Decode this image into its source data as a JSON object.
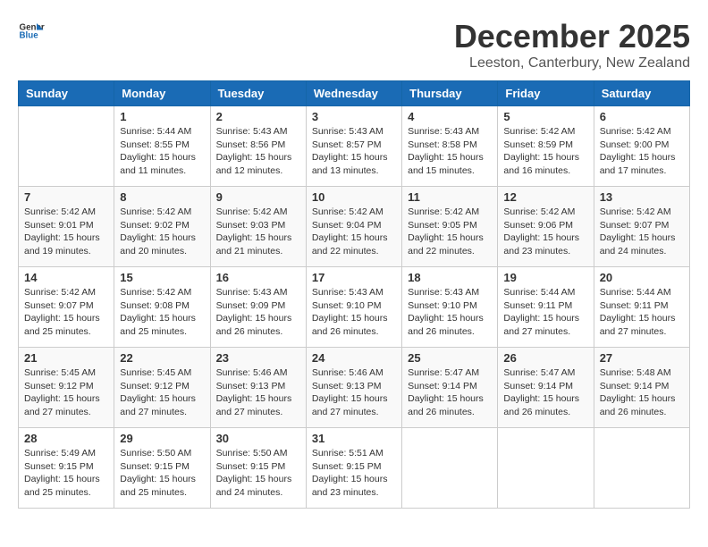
{
  "header": {
    "logo_general": "General",
    "logo_blue": "Blue",
    "month": "December 2025",
    "location": "Leeston, Canterbury, New Zealand"
  },
  "days_of_week": [
    "Sunday",
    "Monday",
    "Tuesday",
    "Wednesday",
    "Thursday",
    "Friday",
    "Saturday"
  ],
  "weeks": [
    [
      {
        "day": "",
        "sunrise": "",
        "sunset": "",
        "daylight": ""
      },
      {
        "day": "1",
        "sunrise": "Sunrise: 5:44 AM",
        "sunset": "Sunset: 8:55 PM",
        "daylight": "Daylight: 15 hours and 11 minutes."
      },
      {
        "day": "2",
        "sunrise": "Sunrise: 5:43 AM",
        "sunset": "Sunset: 8:56 PM",
        "daylight": "Daylight: 15 hours and 12 minutes."
      },
      {
        "day": "3",
        "sunrise": "Sunrise: 5:43 AM",
        "sunset": "Sunset: 8:57 PM",
        "daylight": "Daylight: 15 hours and 13 minutes."
      },
      {
        "day": "4",
        "sunrise": "Sunrise: 5:43 AM",
        "sunset": "Sunset: 8:58 PM",
        "daylight": "Daylight: 15 hours and 15 minutes."
      },
      {
        "day": "5",
        "sunrise": "Sunrise: 5:42 AM",
        "sunset": "Sunset: 8:59 PM",
        "daylight": "Daylight: 15 hours and 16 minutes."
      },
      {
        "day": "6",
        "sunrise": "Sunrise: 5:42 AM",
        "sunset": "Sunset: 9:00 PM",
        "daylight": "Daylight: 15 hours and 17 minutes."
      }
    ],
    [
      {
        "day": "7",
        "sunrise": "Sunrise: 5:42 AM",
        "sunset": "Sunset: 9:01 PM",
        "daylight": "Daylight: 15 hours and 19 minutes."
      },
      {
        "day": "8",
        "sunrise": "Sunrise: 5:42 AM",
        "sunset": "Sunset: 9:02 PM",
        "daylight": "Daylight: 15 hours and 20 minutes."
      },
      {
        "day": "9",
        "sunrise": "Sunrise: 5:42 AM",
        "sunset": "Sunset: 9:03 PM",
        "daylight": "Daylight: 15 hours and 21 minutes."
      },
      {
        "day": "10",
        "sunrise": "Sunrise: 5:42 AM",
        "sunset": "Sunset: 9:04 PM",
        "daylight": "Daylight: 15 hours and 22 minutes."
      },
      {
        "day": "11",
        "sunrise": "Sunrise: 5:42 AM",
        "sunset": "Sunset: 9:05 PM",
        "daylight": "Daylight: 15 hours and 22 minutes."
      },
      {
        "day": "12",
        "sunrise": "Sunrise: 5:42 AM",
        "sunset": "Sunset: 9:06 PM",
        "daylight": "Daylight: 15 hours and 23 minutes."
      },
      {
        "day": "13",
        "sunrise": "Sunrise: 5:42 AM",
        "sunset": "Sunset: 9:07 PM",
        "daylight": "Daylight: 15 hours and 24 minutes."
      }
    ],
    [
      {
        "day": "14",
        "sunrise": "Sunrise: 5:42 AM",
        "sunset": "Sunset: 9:07 PM",
        "daylight": "Daylight: 15 hours and 25 minutes."
      },
      {
        "day": "15",
        "sunrise": "Sunrise: 5:42 AM",
        "sunset": "Sunset: 9:08 PM",
        "daylight": "Daylight: 15 hours and 25 minutes."
      },
      {
        "day": "16",
        "sunrise": "Sunrise: 5:43 AM",
        "sunset": "Sunset: 9:09 PM",
        "daylight": "Daylight: 15 hours and 26 minutes."
      },
      {
        "day": "17",
        "sunrise": "Sunrise: 5:43 AM",
        "sunset": "Sunset: 9:10 PM",
        "daylight": "Daylight: 15 hours and 26 minutes."
      },
      {
        "day": "18",
        "sunrise": "Sunrise: 5:43 AM",
        "sunset": "Sunset: 9:10 PM",
        "daylight": "Daylight: 15 hours and 26 minutes."
      },
      {
        "day": "19",
        "sunrise": "Sunrise: 5:44 AM",
        "sunset": "Sunset: 9:11 PM",
        "daylight": "Daylight: 15 hours and 27 minutes."
      },
      {
        "day": "20",
        "sunrise": "Sunrise: 5:44 AM",
        "sunset": "Sunset: 9:11 PM",
        "daylight": "Daylight: 15 hours and 27 minutes."
      }
    ],
    [
      {
        "day": "21",
        "sunrise": "Sunrise: 5:45 AM",
        "sunset": "Sunset: 9:12 PM",
        "daylight": "Daylight: 15 hours and 27 minutes."
      },
      {
        "day": "22",
        "sunrise": "Sunrise: 5:45 AM",
        "sunset": "Sunset: 9:12 PM",
        "daylight": "Daylight: 15 hours and 27 minutes."
      },
      {
        "day": "23",
        "sunrise": "Sunrise: 5:46 AM",
        "sunset": "Sunset: 9:13 PM",
        "daylight": "Daylight: 15 hours and 27 minutes."
      },
      {
        "day": "24",
        "sunrise": "Sunrise: 5:46 AM",
        "sunset": "Sunset: 9:13 PM",
        "daylight": "Daylight: 15 hours and 27 minutes."
      },
      {
        "day": "25",
        "sunrise": "Sunrise: 5:47 AM",
        "sunset": "Sunset: 9:14 PM",
        "daylight": "Daylight: 15 hours and 26 minutes."
      },
      {
        "day": "26",
        "sunrise": "Sunrise: 5:47 AM",
        "sunset": "Sunset: 9:14 PM",
        "daylight": "Daylight: 15 hours and 26 minutes."
      },
      {
        "day": "27",
        "sunrise": "Sunrise: 5:48 AM",
        "sunset": "Sunset: 9:14 PM",
        "daylight": "Daylight: 15 hours and 26 minutes."
      }
    ],
    [
      {
        "day": "28",
        "sunrise": "Sunrise: 5:49 AM",
        "sunset": "Sunset: 9:15 PM",
        "daylight": "Daylight: 15 hours and 25 minutes."
      },
      {
        "day": "29",
        "sunrise": "Sunrise: 5:50 AM",
        "sunset": "Sunset: 9:15 PM",
        "daylight": "Daylight: 15 hours and 25 minutes."
      },
      {
        "day": "30",
        "sunrise": "Sunrise: 5:50 AM",
        "sunset": "Sunset: 9:15 PM",
        "daylight": "Daylight: 15 hours and 24 minutes."
      },
      {
        "day": "31",
        "sunrise": "Sunrise: 5:51 AM",
        "sunset": "Sunset: 9:15 PM",
        "daylight": "Daylight: 15 hours and 23 minutes."
      },
      {
        "day": "",
        "sunrise": "",
        "sunset": "",
        "daylight": ""
      },
      {
        "day": "",
        "sunrise": "",
        "sunset": "",
        "daylight": ""
      },
      {
        "day": "",
        "sunrise": "",
        "sunset": "",
        "daylight": ""
      }
    ]
  ]
}
